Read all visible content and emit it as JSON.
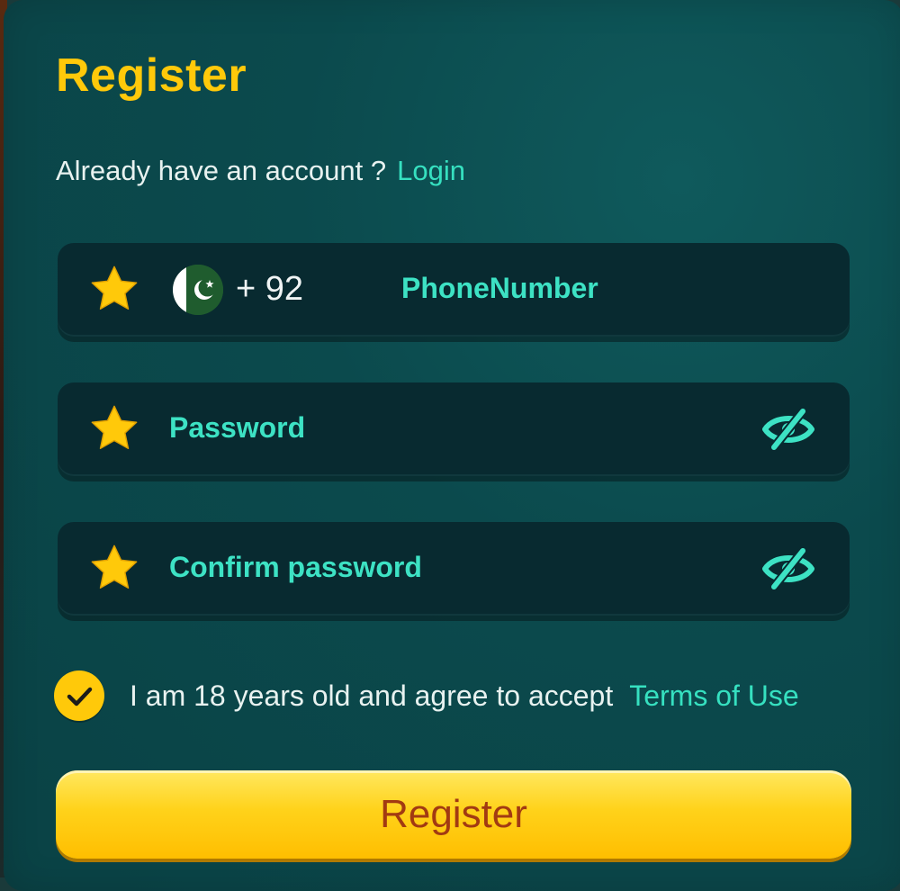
{
  "header": {
    "title": "Register",
    "prompt": "Already have an account ?",
    "login_link": "Login"
  },
  "form": {
    "phone": {
      "country_code": "+ 92",
      "flag_icon": "pakistan-flag-icon",
      "placeholder": "PhoneNumber",
      "value": ""
    },
    "password": {
      "placeholder": "Password",
      "value": "",
      "toggle_icon": "eye-slash-icon"
    },
    "confirm_password": {
      "placeholder": "Confirm password",
      "value": "",
      "toggle_icon": "eye-slash-icon"
    },
    "required_icon": "star-icon"
  },
  "agreement": {
    "checked": true,
    "text": "I am 18 years old and agree to accept",
    "terms_link": "Terms of Use"
  },
  "submit": {
    "label": "Register"
  },
  "colors": {
    "accent_yellow": "#ffc90a",
    "accent_teal": "#36e0c0",
    "panel": "#0b4a4d",
    "field_bg": "#082a30",
    "button_text": "#a23a12"
  }
}
